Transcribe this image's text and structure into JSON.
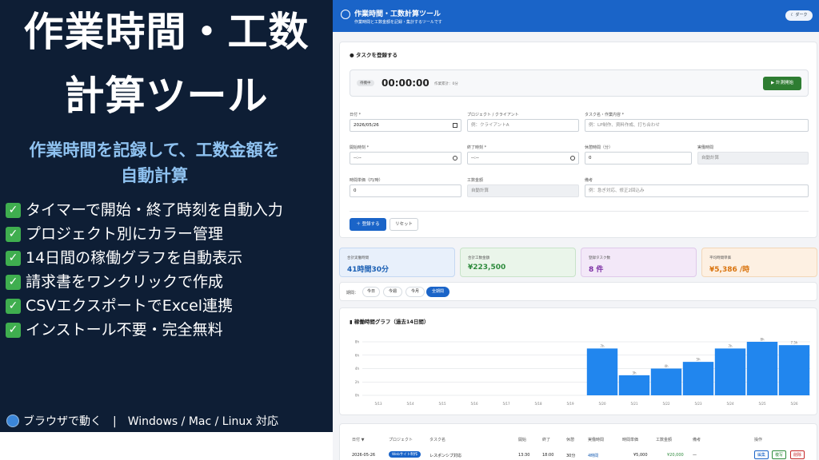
{
  "promo": {
    "title_line1": "作業時間・工数",
    "title_line2": "計算ツール",
    "subtitle_line1": "作業時間を記録して、工数金額を",
    "subtitle_line2": "自動計算",
    "features": [
      "タイマーで開始・終了時刻を自動入力",
      "プロジェクト別にカラー管理",
      "14日間の稼働グラフを自動表示",
      "請求書をワンクリックで作成",
      "CSVエクスポートでExcel連携",
      "インストール不要・完全無料"
    ],
    "footer": "ブラウザで動く　|　Windows / Mac / Linux 対応"
  },
  "app": {
    "title": "作業時間・工数計算ツール",
    "subtitle": "作業時間と工数金額を記録・集計するツールです",
    "dark_button": "ダーク"
  },
  "task_form": {
    "title": "タスクを登録する",
    "status_badge": "待機中",
    "timer": "00:00:00",
    "elapsed_label": "作業累計：0分",
    "start_button": "▶ 計測開始",
    "date_label": "日付 *",
    "date_value": "2026/05/26",
    "project_label": "プロジェクト / クライアント",
    "project_placeholder": "例：クライアントA",
    "task_label": "タスク名・作業内容 *",
    "task_placeholder": "例：LP制作、資料作成、打ち合わせ",
    "start_label": "開始時刻 *",
    "start_value": "--:--",
    "end_label": "終了時刻 *",
    "end_value": "--:--",
    "break_label": "休憩時間（分）",
    "break_value": "0",
    "actual_label": "実働時間",
    "actual_value": "自動計算",
    "rate_label": "時間単価（円/時）",
    "rate_value": "0",
    "amount_label": "工数金額",
    "amount_value": "自動計算",
    "memo_label": "備考",
    "memo_placeholder": "例：急ぎ対応、修正2回込み",
    "register_button": "＋ 登録する",
    "reset_button": "リセット"
  },
  "stats": [
    {
      "label": "合計実働時間",
      "value": "41時間30分",
      "color": "#1a5fb4"
    },
    {
      "label": "合計工数金額",
      "value": "¥223,500",
      "color": "#2e8b3d"
    },
    {
      "label": "登録タスク数",
      "value": "8 件",
      "color": "#7b2ea3"
    },
    {
      "label": "平均時間単価",
      "value": "¥5,386 /時",
      "color": "#d9730d"
    }
  ],
  "period": {
    "label": "期間：",
    "options": [
      "今日",
      "今週",
      "今月",
      "全期間"
    ],
    "active": "全期間"
  },
  "chart_title": "稼働時間グラフ（過去14日間）",
  "chart_data": {
    "type": "bar",
    "title": "稼働時間グラフ（過去14日間）",
    "categories": [
      "5/13",
      "5/14",
      "5/15",
      "5/16",
      "5/17",
      "5/18",
      "5/19",
      "5/20",
      "5/21",
      "5/22",
      "5/23",
      "5/24",
      "5/25",
      "5/26"
    ],
    "values": [
      0,
      0,
      0,
      0,
      0,
      0,
      0,
      7,
      3,
      4,
      5,
      7,
      8,
      7.5
    ],
    "value_labels": [
      "",
      "",
      "",
      "",
      "",
      "",
      "",
      "7h",
      "3h",
      "4h",
      "5h",
      "7h",
      "8h",
      "7.5h"
    ],
    "y_ticks": [
      "0h",
      "2h",
      "4h",
      "6h",
      "8h"
    ],
    "ylim": [
      0,
      8
    ],
    "bar_color": "#2186ee"
  },
  "table": {
    "headers": [
      "日付 ▼",
      "プロジェクト",
      "タスク名",
      "開始",
      "終了",
      "休憩",
      "実働時間",
      "時間単価",
      "工数金額",
      "備考",
      "操作"
    ],
    "row": {
      "date": "2026-05-26",
      "project": "Webサイト制作",
      "task": "レスポンシブ対応",
      "start": "13:30",
      "end": "18:00",
      "break": "30分",
      "actual": "4時間",
      "rate": "¥5,000",
      "amount": "¥20,000",
      "memo": "—",
      "edit": "編集",
      "copy": "複写",
      "delete": "削除"
    }
  }
}
